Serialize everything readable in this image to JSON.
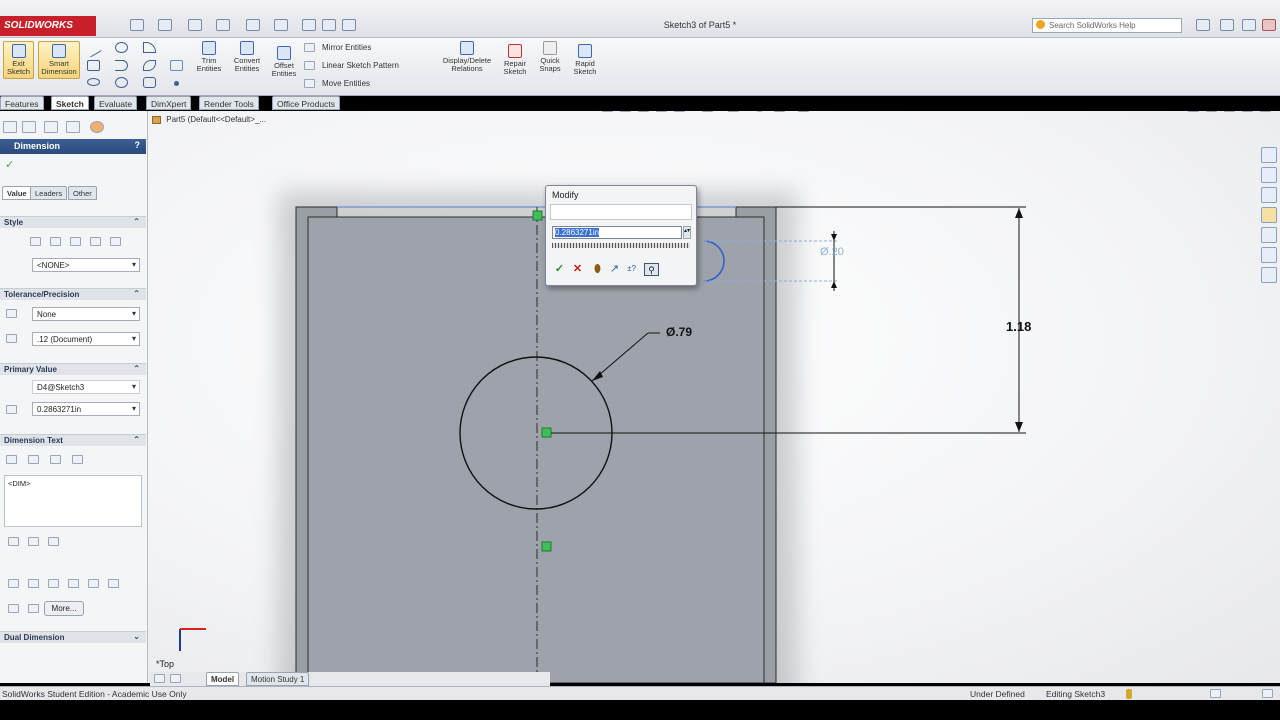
{
  "app": {
    "logo_text": "SOLIDWORKS",
    "document_title": "Sketch3 of Part5 *",
    "help_search_placeholder": "Search SolidWorks Help"
  },
  "ribbon": {
    "exit_sketch": "Exit Sketch",
    "smart_dimension": "Smart Dimension",
    "trim_entities": "Trim Entities",
    "convert_entities": "Convert Entities",
    "offset_entities": "Offset Entities",
    "mirror_entities": "Mirror Entities",
    "linear_sketch_pattern": "Linear Sketch Pattern",
    "move_entities": "Move Entities",
    "display_delete_relations": "Display/Delete Relations",
    "repair_sketch": "Repair Sketch",
    "quick_snaps": "Quick Snaps",
    "rapid_sketch": "Rapid Sketch"
  },
  "tabs": [
    "Features",
    "Sketch",
    "Evaluate",
    "DimXpert",
    "Render Tools",
    "Office Products"
  ],
  "active_tab": "Sketch",
  "feature_tree": {
    "root": "Part5 (Default<<Default>_..."
  },
  "property_manager": {
    "title": "Dimension",
    "subtabs": [
      "Value",
      "Leaders",
      "Other"
    ],
    "style": {
      "header": "Style",
      "dropdown": "<NONE>"
    },
    "tolerance": {
      "header": "Tolerance/Precision",
      "type": "None",
      "precision": ".12 (Document)"
    },
    "primary_value": {
      "header": "Primary Value",
      "name": "D4@Sketch3",
      "value": "0.2863271in"
    },
    "dimension_text": {
      "header": "Dimension Text",
      "text": "<DIM>",
      "more_button": "More..."
    },
    "dual_dimension": "Dual Dimension"
  },
  "modify_dialog": {
    "title": "Modify",
    "value": "0.2863271in"
  },
  "drawing": {
    "dim_height": "1.18",
    "dim_diameter_large": "Ø.79",
    "dim_diameter_small": "Ø.20",
    "view_label": "*Top"
  },
  "bottom_tabs": [
    "Model",
    "Motion Study 1"
  ],
  "status": {
    "edition": "SolidWorks Student Edition - Academic Use Only",
    "defined_state": "Under Defined",
    "editing": "Editing Sketch3"
  }
}
